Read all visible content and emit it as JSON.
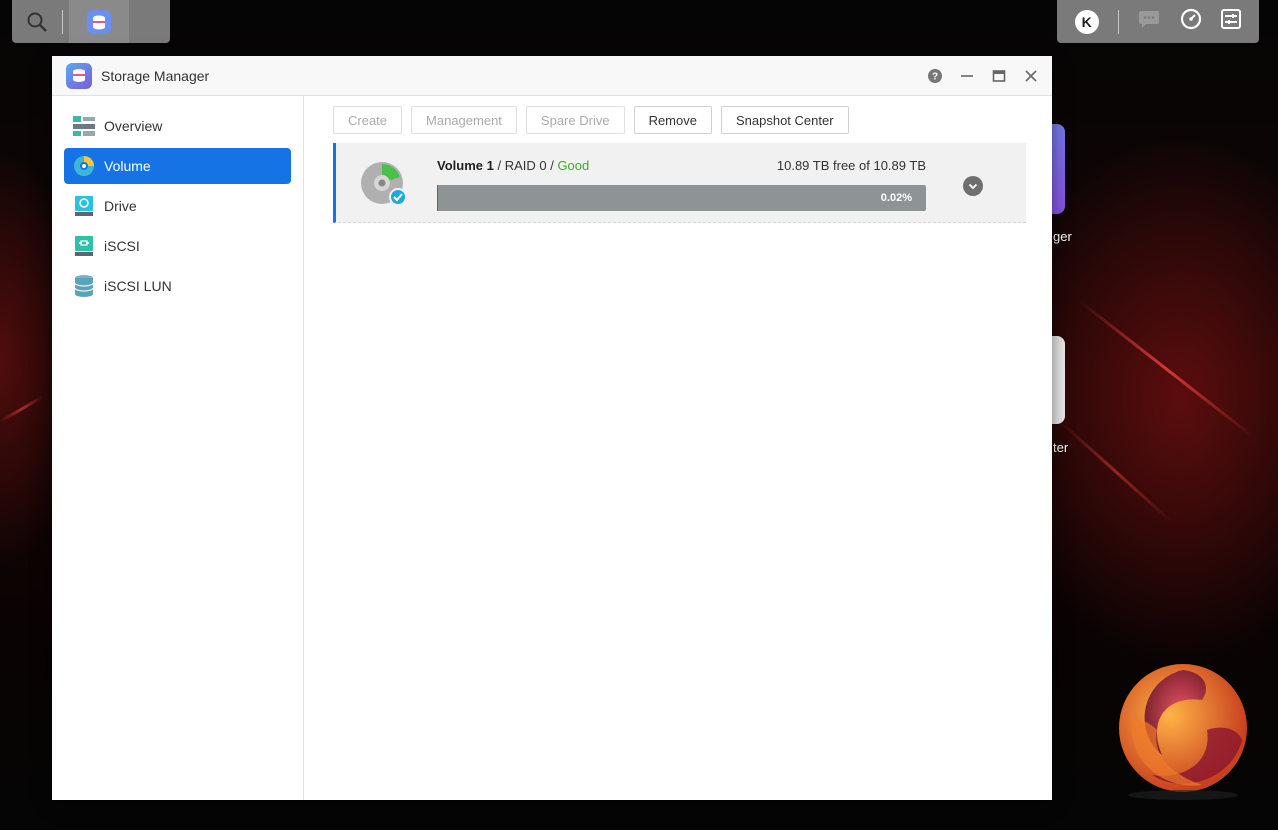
{
  "taskbar": {
    "search_icon": "search-icon",
    "active_app_icon": "storage-manager-icon",
    "user_initial": "K",
    "icons": [
      "chat-icon",
      "dashboard-icon",
      "settings-sliders-icon"
    ]
  },
  "desktop": {
    "label_1": "ger",
    "label_2": "ter"
  },
  "window": {
    "title": "Storage Manager",
    "controls": [
      "help-icon",
      "minimize-icon",
      "maximize-icon",
      "close-icon"
    ]
  },
  "sidebar": {
    "items": [
      {
        "label": "Overview",
        "icon": "overview-icon"
      },
      {
        "label": "Volume",
        "icon": "volume-icon",
        "active": true
      },
      {
        "label": "Drive",
        "icon": "drive-icon"
      },
      {
        "label": "iSCSI",
        "icon": "iscsi-icon"
      },
      {
        "label": "iSCSI LUN",
        "icon": "iscsi-lun-icon"
      }
    ]
  },
  "toolbar": {
    "create_label": "Create",
    "management_label": "Management",
    "spare_drive_label": "Spare Drive",
    "remove_label": "Remove",
    "snapshot_center_label": "Snapshot Center"
  },
  "volume": {
    "name": "Volume 1",
    "sep1": " / ",
    "raid": "RAID 0",
    "sep2": " / ",
    "status": "Good",
    "capacity_text": "10.89 TB free of 10.89 TB",
    "usage_label": "0.02%",
    "usage_fraction": 0.0002
  },
  "colors": {
    "accent": "#1673e6",
    "good": "#3daa2a",
    "bar_bg": "#8e9396"
  }
}
